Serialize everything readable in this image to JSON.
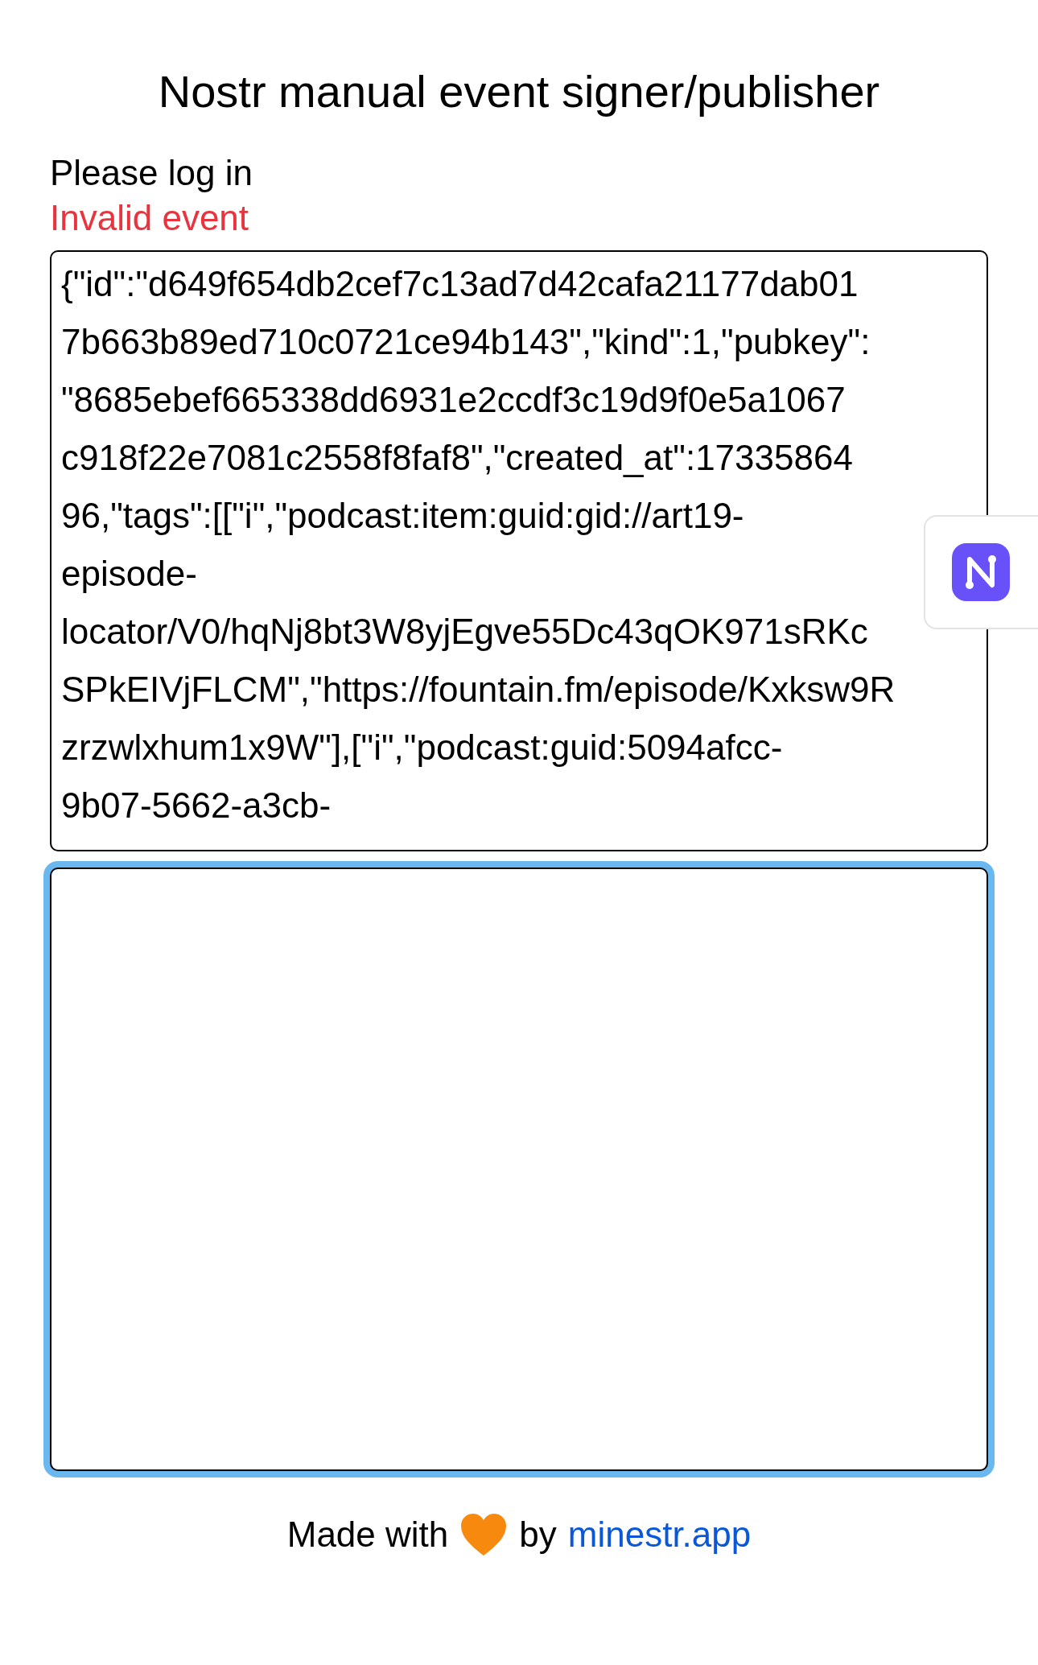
{
  "title": "Nostr manual event signer/publisher",
  "status": "Please log in",
  "error": "Invalid event",
  "event_field": {
    "focused": false,
    "lines": [
      "{\"id\":\"d649f654db2cef7c13ad7d42cafa21177dab01",
      "7b663b89ed710c0721ce94b143\",\"kind\":1,\"pubkey\":",
      "\"8685ebef665338dd6931e2ccdf3c19d9f0e5a1067",
      "c918f22e7081c2558f8faf8\",\"created_at\":17335864",
      "96,\"tags\":[[\"i\",\"podcast:item:guid:gid://art19-",
      "episode-",
      "locator/V0/hqNj8bt3W8yjEgve55Dc43qOK971sRKc",
      "SPkEIVjFLCM\",\"https://fountain.fm/episode/Kxksw9R",
      "zrzwlxhum1x9W\"],[\"i\",\"podcast:guid:5094afcc-",
      "9b07-5662-a3cb-"
    ]
  },
  "output_field": {
    "focused": true
  },
  "footer": {
    "before": "Made with",
    "after": "by",
    "link": "minestr.app"
  }
}
